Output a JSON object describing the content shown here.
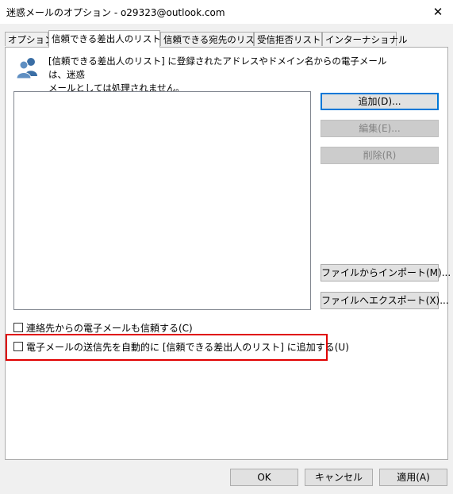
{
  "window": {
    "title": "迷惑メールのオプション - o29323@outlook.com",
    "close_label": "✕"
  },
  "tabs": [
    {
      "label": "オプション",
      "active": false
    },
    {
      "label": "信頼できる差出人のリスト",
      "active": true
    },
    {
      "label": "信頼できる宛先のリスト",
      "active": false
    },
    {
      "label": "受信拒否リスト",
      "active": false
    },
    {
      "label": "インターナショナル",
      "active": false
    }
  ],
  "panel": {
    "info_icon": "people-icon",
    "info_text_line1": "[信頼できる差出人のリスト] に登録されたアドレスやドメイン名からの電子メールは、迷惑",
    "info_text_line2": "メールとしては処理されません。",
    "buttons": {
      "add": "追加(D)...",
      "edit": "編集(E)...",
      "remove": "削除(R)",
      "import": "ファイルからインポート(M)...",
      "export": "ファイルへエクスポート(X)..."
    },
    "checkboxes": {
      "trust_contacts": {
        "label": "連絡先からの電子メールも信頼する(C)",
        "checked": false
      },
      "auto_add_recipients": {
        "label": "電子メールの送信先を自動的に [信頼できる差出人のリスト] に追加する(U)",
        "checked": false
      }
    }
  },
  "footer": {
    "ok": "OK",
    "cancel": "キャンセル",
    "apply": "適用(A)"
  },
  "colors": {
    "accent": "#0078d7",
    "highlight": "#e00000",
    "icon": "#3a6ea5"
  }
}
